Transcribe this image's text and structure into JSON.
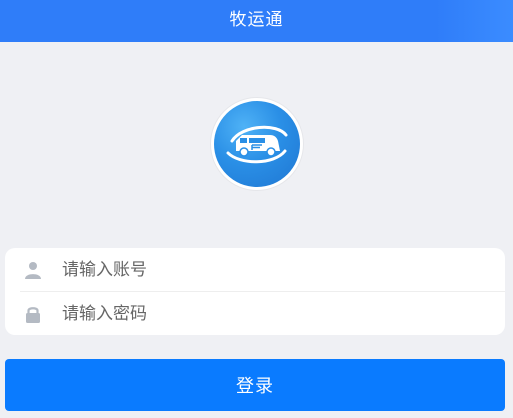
{
  "header": {
    "title": "牧运通"
  },
  "logo": {
    "icon": "camper-van-logo-icon"
  },
  "form": {
    "account": {
      "icon": "user-icon",
      "placeholder": "请输入账号",
      "value": ""
    },
    "password": {
      "icon": "lock-icon",
      "placeholder": "请输入密码",
      "value": ""
    }
  },
  "login_button": {
    "label": "登录"
  },
  "colors": {
    "header_bg": "#2f7df9",
    "button_bg": "#0a7bff",
    "page_bg": "#eff0f4",
    "icon_gray": "#b4bac3"
  }
}
